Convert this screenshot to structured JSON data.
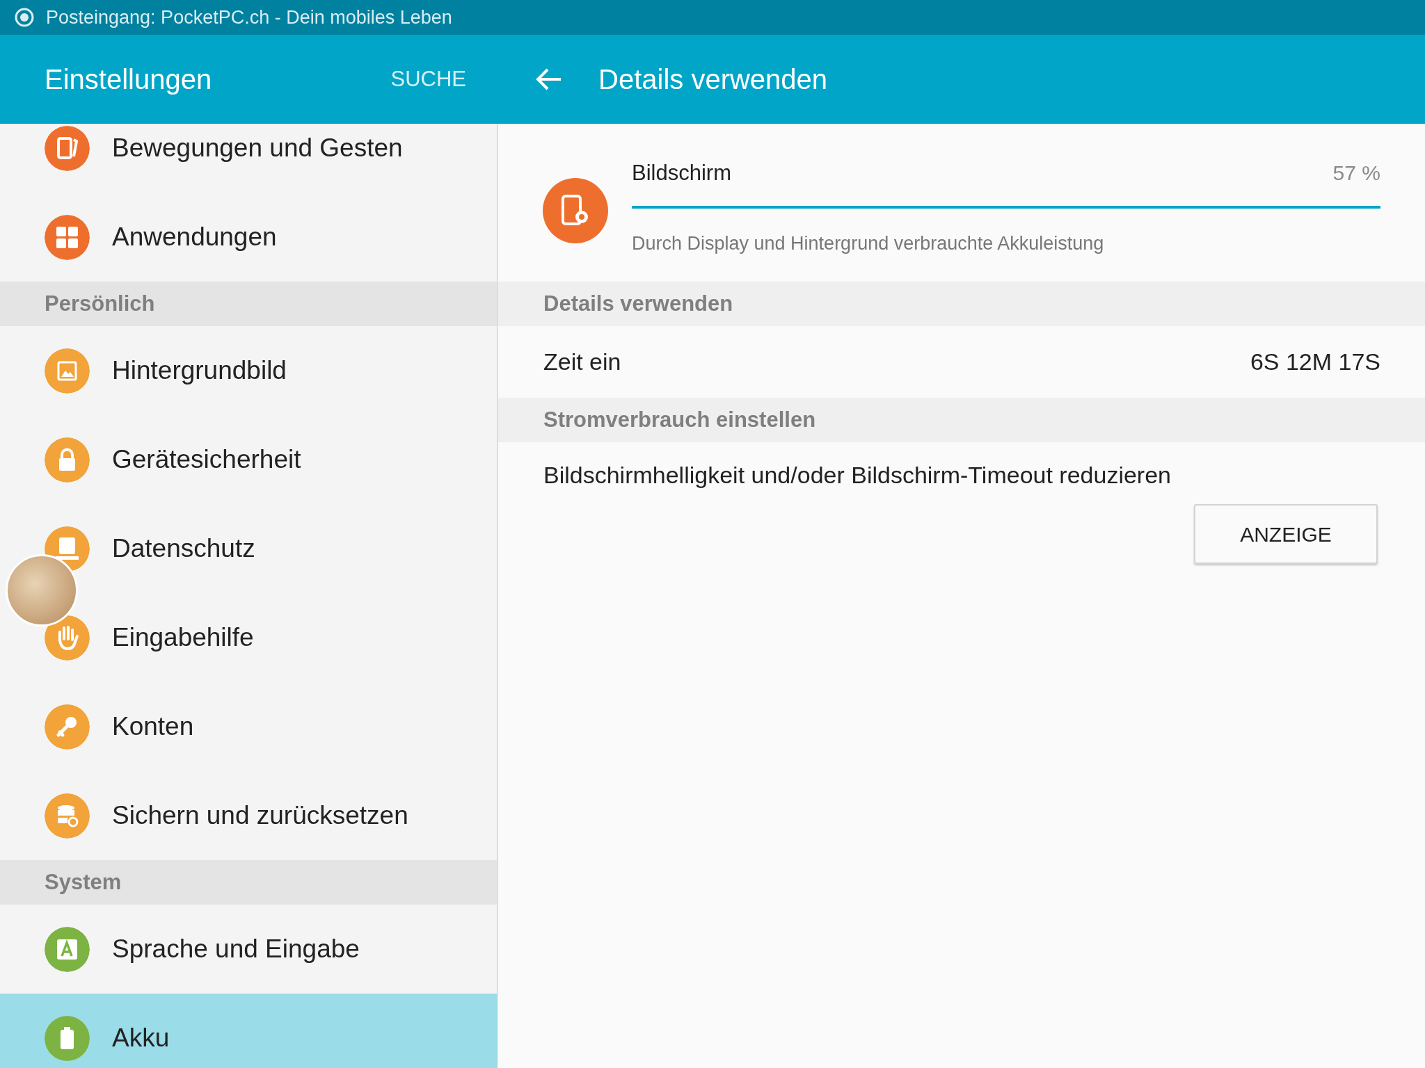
{
  "status_bar": {
    "notification": "Posteingang: PocketPC.ch - Dein mobiles Leben"
  },
  "sidebar": {
    "title": "Einstellungen",
    "search": "SUCHE",
    "groups": [
      {
        "items": [
          {
            "label": "Bewegungen und Gesten",
            "kind": "gesture",
            "color": "#ee6f2d",
            "selected": false
          },
          {
            "label": "Anwendungen",
            "kind": "apps",
            "color": "#ee6f2d",
            "selected": false
          }
        ]
      },
      {
        "header": "Persönlich",
        "items": [
          {
            "label": "Hintergrundbild",
            "kind": "wallpaper",
            "color": "#f2a33a",
            "selected": false
          },
          {
            "label": "Gerätesicherheit",
            "kind": "lock",
            "color": "#f2a33a",
            "selected": false
          },
          {
            "label": "Datenschutz",
            "kind": "privacy",
            "color": "#f2a33a",
            "selected": false
          },
          {
            "label": "Eingabehilfe",
            "kind": "hand",
            "color": "#f2a33a",
            "selected": false
          },
          {
            "label": "Konten",
            "kind": "key",
            "color": "#f2a33a",
            "selected": false
          },
          {
            "label": "Sichern und zurücksetzen",
            "kind": "backup",
            "color": "#f2a33a",
            "selected": false
          }
        ]
      },
      {
        "header": "System",
        "items": [
          {
            "label": "Sprache und Eingabe",
            "kind": "language",
            "color": "#7cb342",
            "selected": false
          },
          {
            "label": "Akku",
            "kind": "battery",
            "color": "#7cb342",
            "selected": true
          }
        ]
      }
    ]
  },
  "detail": {
    "title": "Details verwenden",
    "app": {
      "name": "Bildschirm",
      "percent": "57 %",
      "level": 1.0,
      "description": "Durch Display und Hintergrund verbrauchte Akkuleistung"
    },
    "sections": [
      {
        "header": "Details verwenden",
        "rows": [
          {
            "label": "Zeit ein",
            "value": "6S 12M 17S"
          }
        ]
      },
      {
        "header": "Stromverbrauch einstellen",
        "text": "Bildschirmhelligkeit und/oder Bildschirm-Timeout reduzieren",
        "button": "ANZEIGE"
      }
    ]
  }
}
